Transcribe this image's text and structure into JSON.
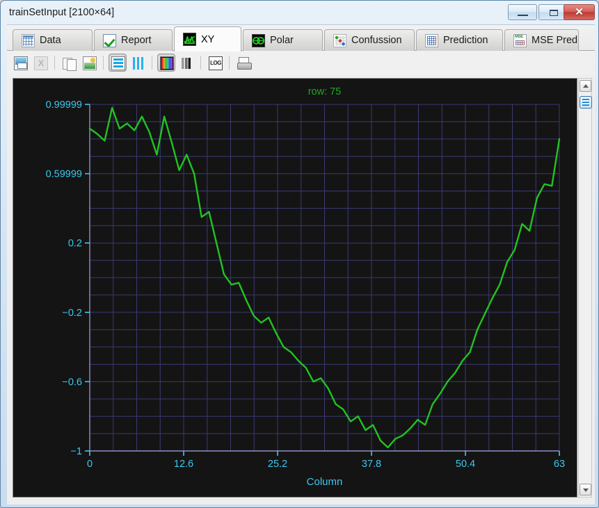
{
  "window": {
    "title": "trainSetInput [2100×64]",
    "buttons": {
      "minimize": "–",
      "maximize": "□",
      "close": "✕"
    }
  },
  "tabs": [
    {
      "label": "Data",
      "icon": "table-grid-icon",
      "active": false
    },
    {
      "label": "Report",
      "icon": "check-mark-icon",
      "active": false
    },
    {
      "label": "XY",
      "icon": "xy-waveform-icon",
      "active": true
    },
    {
      "label": "Polar",
      "icon": "polar-plot-icon",
      "active": false
    },
    {
      "label": "Confussion",
      "icon": "confusion-dots-icon",
      "active": false
    },
    {
      "label": "Prediction",
      "icon": "prediction-grid-icon",
      "active": false
    },
    {
      "label": "MSE Pred",
      "icon": "mse-grid-icon",
      "active": false
    }
  ],
  "toolbar": {
    "buttons": [
      {
        "name": "save-image-button",
        "icon": "save-image-icon",
        "pressed": false,
        "enabled": true
      },
      {
        "name": "export-excel-button",
        "icon": "excel-export-icon",
        "pressed": false,
        "enabled": false
      },
      {
        "name": "copy-data-button",
        "icon": "copy-pages-icon",
        "pressed": false,
        "enabled": true
      },
      {
        "name": "copy-image-button",
        "icon": "copy-image-icon",
        "pressed": false,
        "enabled": true
      },
      {
        "name": "row-view-button",
        "icon": "horizontal-bars-icon",
        "pressed": true,
        "enabled": true
      },
      {
        "name": "column-view-button",
        "icon": "vertical-bars-icon",
        "pressed": false,
        "enabled": true
      },
      {
        "name": "color-map-button",
        "icon": "color-bars-icon",
        "pressed": true,
        "enabled": true
      },
      {
        "name": "gray-map-button",
        "icon": "gray-bars-icon",
        "pressed": false,
        "enabled": true
      },
      {
        "name": "log-scale-button",
        "icon": "log-scale-icon",
        "pressed": false,
        "enabled": true
      },
      {
        "name": "print-button",
        "icon": "printer-icon",
        "pressed": false,
        "enabled": true
      }
    ],
    "log_label": "LOG",
    "excel_label": "X"
  },
  "sidebar": {
    "scroll_up": "▲",
    "scroll_down": "▼",
    "row_select": "row-list-icon"
  },
  "chart_data": {
    "type": "line",
    "title": "row: 75",
    "xlabel": "Column",
    "ylabel": "",
    "xlim": [
      0,
      63
    ],
    "ylim": [
      -1,
      0.99999
    ],
    "grid": true,
    "legend": "none",
    "line_color": "#22c322",
    "axis_color": "#3dc8f0",
    "grid_color": "#3a3a74",
    "background": "#141414",
    "title_color": "#22a822",
    "xticks": [
      0,
      12.6,
      25.2,
      37.8,
      50.4,
      63
    ],
    "xticklabels": [
      "0",
      "12.6",
      "25.2",
      "37.8",
      "50.4",
      "63"
    ],
    "yticks": [
      0.99999,
      0.59999,
      0.2,
      -0.2,
      -0.6,
      -1
    ],
    "yticklabels": [
      "0.99999",
      "0.59999",
      "0.2",
      "−0.2",
      "−0.6",
      "−1"
    ],
    "x": [
      0,
      1,
      2,
      3,
      4,
      5,
      6,
      7,
      8,
      9,
      10,
      11,
      12,
      13,
      14,
      15,
      16,
      17,
      18,
      19,
      20,
      21,
      22,
      23,
      24,
      25,
      26,
      27,
      28,
      29,
      30,
      31,
      32,
      33,
      34,
      35,
      36,
      37,
      38,
      39,
      40,
      41,
      42,
      43,
      44,
      45,
      46,
      47,
      48,
      49,
      50,
      51,
      52,
      53,
      54,
      55,
      56,
      57,
      58,
      59,
      60,
      61,
      62,
      63
    ],
    "y": [
      0.86,
      0.83,
      0.79,
      0.98,
      0.86,
      0.89,
      0.85,
      0.93,
      0.84,
      0.71,
      0.93,
      0.78,
      0.62,
      0.71,
      0.6,
      0.35,
      0.38,
      0.2,
      0.02,
      -0.04,
      -0.03,
      -0.13,
      -0.22,
      -0.26,
      -0.23,
      -0.32,
      -0.4,
      -0.43,
      -0.48,
      -0.52,
      -0.6,
      -0.58,
      -0.64,
      -0.73,
      -0.76,
      -0.83,
      -0.8,
      -0.88,
      -0.85,
      -0.94,
      -0.98,
      -0.93,
      -0.91,
      -0.87,
      -0.82,
      -0.85,
      -0.73,
      -0.67,
      -0.6,
      -0.55,
      -0.48,
      -0.43,
      -0.3,
      -0.21,
      -0.12,
      -0.04,
      0.09,
      0.16,
      0.31,
      0.27,
      0.46,
      0.54,
      0.53,
      0.8
    ]
  }
}
